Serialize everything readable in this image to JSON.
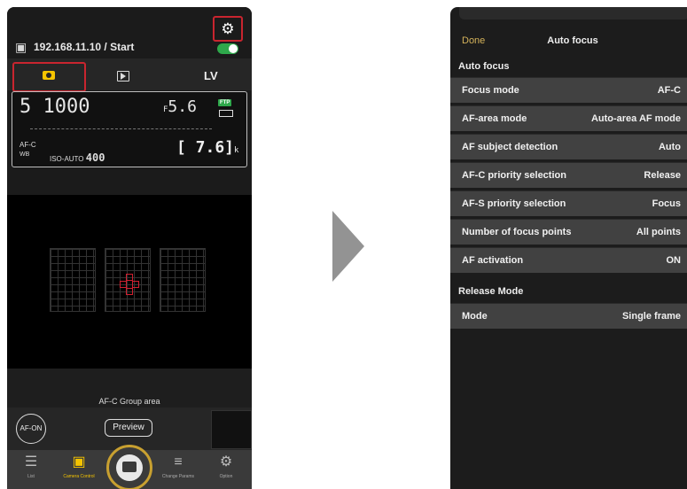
{
  "left_screen": {
    "connection": "192.168.11.10 / Start",
    "tabs": {
      "live_view": "LV"
    },
    "lcd": {
      "shutter": "5  1000",
      "fnum_prefix": "F",
      "fnum": "5.6",
      "ftp": "FTP",
      "af_line": "AF-C",
      "wb": "WB",
      "iso_label": "ISO-AUTO",
      "iso_value": "400",
      "shots": "[ 7.6]",
      "shots_unit": "k"
    },
    "status_text": "AF-C  Group area",
    "af_on_label": "AF-ON",
    "preview_label": "Preview",
    "nav": [
      {
        "label": "List",
        "icon": "list-icon"
      },
      {
        "label": "Camera Control",
        "icon": "camera-control-icon"
      },
      {
        "label": "Change Params",
        "icon": "sliders-icon"
      },
      {
        "label": "Option",
        "icon": "gear-icon"
      }
    ]
  },
  "right_screen": {
    "done_label": "Done",
    "title": "Auto focus",
    "sections": [
      {
        "header": "Auto focus",
        "rows": [
          {
            "label": "Focus mode",
            "value": "AF-C"
          },
          {
            "label": "AF-area mode",
            "value": "Auto-area AF mode"
          },
          {
            "label": "AF subject detection",
            "value": "Auto"
          },
          {
            "label": "AF-C priority selection",
            "value": "Release"
          },
          {
            "label": "AF-S priority selection",
            "value": "Focus"
          },
          {
            "label": "Number of focus points",
            "value": "All points"
          },
          {
            "label": "AF activation",
            "value": "ON"
          }
        ]
      },
      {
        "header": "Release Mode",
        "rows": [
          {
            "label": "Mode",
            "value": "Single frame"
          }
        ]
      }
    ]
  },
  "colors": {
    "highlight": "#c9252f",
    "accent_yellow": "#f5c400",
    "toggle_green": "#2ea84b",
    "done_gold": "#d4b25a"
  }
}
